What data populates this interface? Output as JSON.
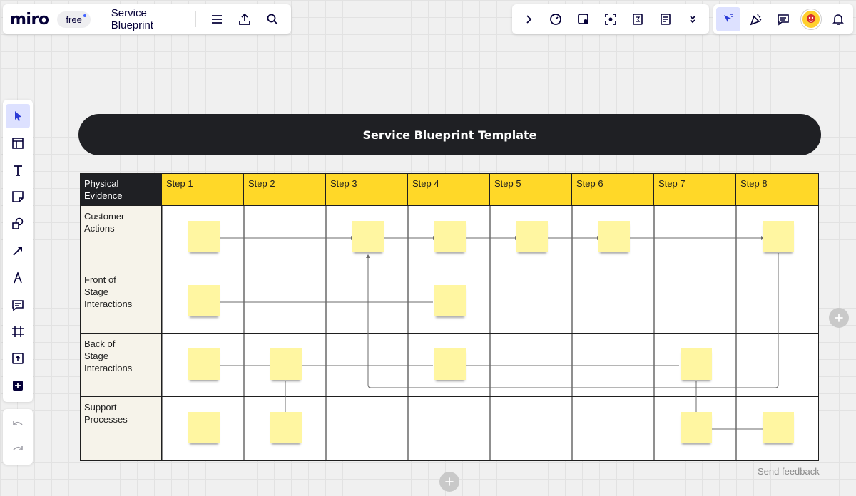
{
  "app": {
    "logo": "miro",
    "plan_badge": "free",
    "board_title": "Service Blueprint"
  },
  "toolbar_left_icons": [
    "menu-icon",
    "upload-icon",
    "search-icon"
  ],
  "toolbar_mid_icons": [
    "chevron-right-icon",
    "timer-icon",
    "voting-icon",
    "focus-icon",
    "calendar-icon",
    "notes-icon",
    "chevron-double-down-icon"
  ],
  "toolbar_right_icons": [
    "cursor-select-icon",
    "reactions-icon",
    "comment-icon",
    "avatar",
    "bell-icon"
  ],
  "left_tools": [
    "select-icon",
    "template-icon",
    "text-icon",
    "sticky-note-icon",
    "shapes-icon",
    "arrow-icon",
    "pen-icon",
    "comment-icon",
    "frame-icon",
    "upload-icon",
    "more-icon"
  ],
  "banner": {
    "title": "Service Blueprint Template"
  },
  "blueprint": {
    "corner_label": "Physical\nEvidence",
    "steps": [
      "Step 1",
      "Step 2",
      "Step 3",
      "Step 4",
      "Step 5",
      "Step 6",
      "Step 7",
      "Step 8"
    ],
    "rows": [
      "Customer\nActions",
      "Front of\nStage Interactions",
      "Back of\nStage Interactions",
      "Support\nProcesses"
    ]
  },
  "feedback_link": "Send feedback",
  "colors": {
    "header_yellow": "#ffd828",
    "banner_dark": "#1f2024",
    "sticky_yellow": "#fff6a1",
    "row_header_bg": "#f6f3ea",
    "accent_blue": "#4262ff"
  }
}
